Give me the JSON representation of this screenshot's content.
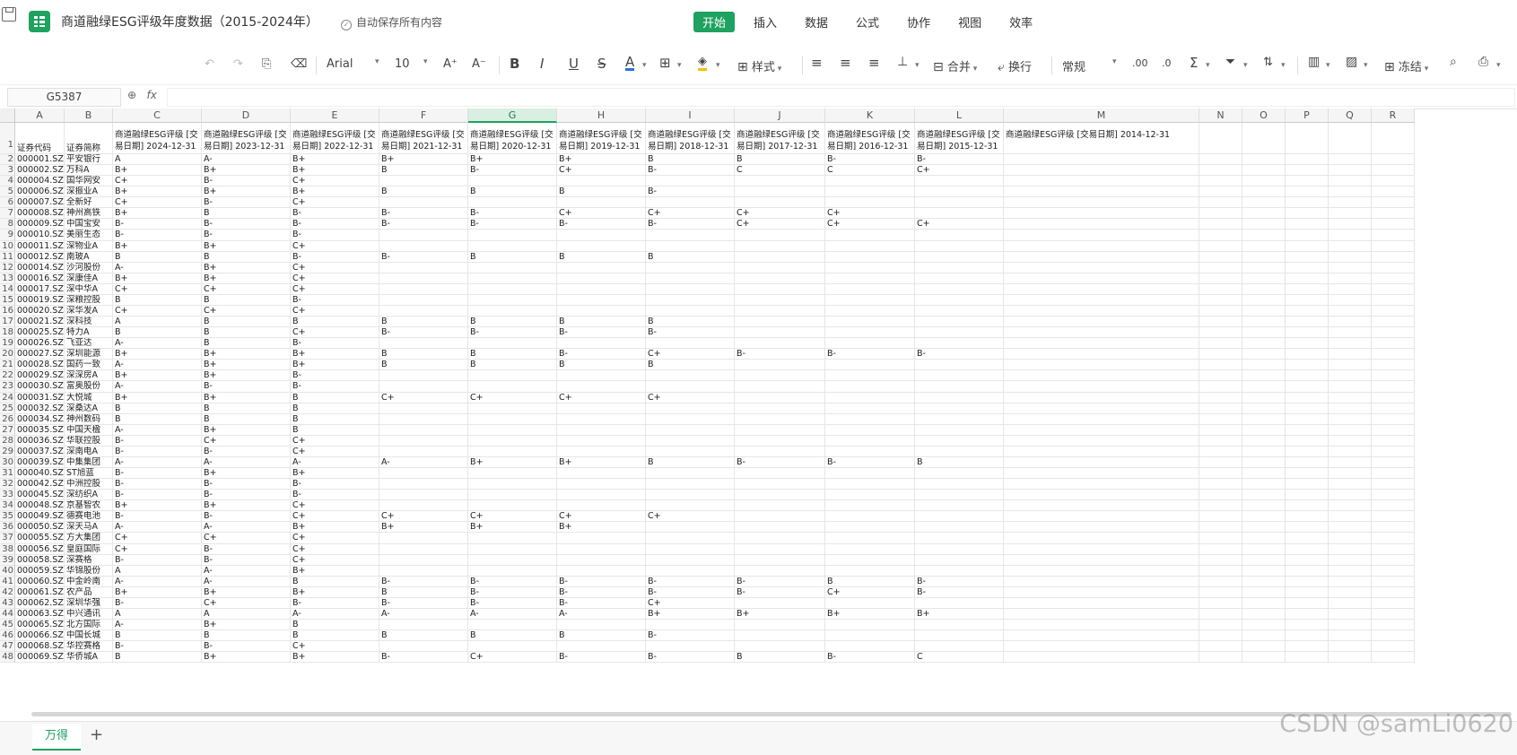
{
  "app": {
    "doc_title": "商道融绿ESG评级年度数据（2015-2024年）",
    "autosave_text": "自动保存所有内容",
    "menu": [
      "开始",
      "插入",
      "数据",
      "公式",
      "协作",
      "视图",
      "效率"
    ],
    "active_menu_index": 0,
    "accent_color": "#1fa15f"
  },
  "toolbar": {
    "font_name": "Arial",
    "font_size": "10",
    "bold": "B",
    "italic": "I",
    "underline": "U",
    "strike": "S",
    "font_color": "A",
    "style_label": "样式",
    "merge_label": "合并",
    "wrap_label": "换行",
    "number_format": "常规",
    "freeze_label": "冻结"
  },
  "formula_bar": {
    "cell_ref": "G5387",
    "fx": "fx",
    "content": ""
  },
  "grid": {
    "columns": [
      "A",
      "B",
      "C",
      "D",
      "E",
      "F",
      "G",
      "H",
      "I",
      "J",
      "K",
      "L",
      "M",
      "N",
      "O",
      "P",
      "Q",
      "R"
    ],
    "selected_column": "G",
    "header_row": [
      "证券代码",
      "证券简称",
      "商道融绿ESG评级 [交易日期] 2024-12-31",
      "商道融绿ESG评级 [交易日期] 2023-12-31",
      "商道融绿ESG评级 [交易日期] 2022-12-31",
      "商道融绿ESG评级 [交易日期] 2021-12-31",
      "商道融绿ESG评级 [交易日期] 2020-12-31",
      "商道融绿ESG评级 [交易日期] 2019-12-31",
      "商道融绿ESG评级 [交易日期] 2018-12-31",
      "商道融绿ESG评级 [交易日期] 2017-12-31",
      "商道融绿ESG评级 [交易日期] 2016-12-31",
      "商道融绿ESG评级 [交易日期] 2015-12-31",
      "商道融绿ESG评级 [交易日期] 2014-12-31"
    ],
    "rows": [
      [
        "000001.SZ",
        "平安银行",
        "A",
        "A-",
        "B+",
        "B+",
        "B+",
        "B+",
        "B",
        "B",
        "B-",
        "B-"
      ],
      [
        "000002.SZ",
        "万科A",
        "B+",
        "B+",
        "B+",
        "B",
        "B-",
        "C+",
        "B-",
        "C",
        "C",
        "C+"
      ],
      [
        "000004.SZ",
        "国华网安",
        "C+",
        "B-",
        "C+",
        "",
        "",
        "",
        "",
        "",
        "",
        ""
      ],
      [
        "000006.SZ",
        "深振业A",
        "B+",
        "B+",
        "B+",
        "B",
        "B",
        "B",
        "B-",
        "",
        "",
        ""
      ],
      [
        "000007.SZ",
        "全新好",
        "C+",
        "B-",
        "C+",
        "",
        "",
        "",
        "",
        "",
        "",
        ""
      ],
      [
        "000008.SZ",
        "神州高铁",
        "B+",
        "B",
        "B-",
        "B-",
        "B-",
        "C+",
        "C+",
        "C+",
        "C+",
        ""
      ],
      [
        "000009.SZ",
        "中国宝安",
        "B-",
        "B-",
        "B-",
        "B-",
        "B-",
        "B-",
        "B-",
        "C+",
        "C+",
        "C+"
      ],
      [
        "000010.SZ",
        "美丽生态",
        "B-",
        "B-",
        "B-",
        "",
        "",
        "",
        "",
        "",
        "",
        ""
      ],
      [
        "000011.SZ",
        "深物业A",
        "B+",
        "B+",
        "C+",
        "",
        "",
        "",
        "",
        "",
        "",
        ""
      ],
      [
        "000012.SZ",
        "南玻A",
        "B",
        "B",
        "B-",
        "B-",
        "B",
        "B",
        "B",
        "",
        "",
        ""
      ],
      [
        "000014.SZ",
        "沙河股份",
        "A-",
        "B+",
        "C+",
        "",
        "",
        "",
        "",
        "",
        "",
        ""
      ],
      [
        "000016.SZ",
        "深康佳A",
        "B+",
        "B+",
        "C+",
        "",
        "",
        "",
        "",
        "",
        "",
        ""
      ],
      [
        "000017.SZ",
        "深中华A",
        "C+",
        "C+",
        "C+",
        "",
        "",
        "",
        "",
        "",
        "",
        ""
      ],
      [
        "000019.SZ",
        "深粮控股",
        "B",
        "B",
        "B-",
        "",
        "",
        "",
        "",
        "",
        "",
        ""
      ],
      [
        "000020.SZ",
        "深华发A",
        "C+",
        "C+",
        "C+",
        "",
        "",
        "",
        "",
        "",
        "",
        ""
      ],
      [
        "000021.SZ",
        "深科技",
        "A",
        "B",
        "B",
        "B",
        "B",
        "B",
        "B",
        "",
        "",
        ""
      ],
      [
        "000025.SZ",
        "特力A",
        "B",
        "B",
        "C+",
        "B-",
        "B-",
        "B-",
        "B-",
        "",
        "",
        ""
      ],
      [
        "000026.SZ",
        "飞亚达",
        "A-",
        "B",
        "B-",
        "",
        "",
        "",
        "",
        "",
        "",
        ""
      ],
      [
        "000027.SZ",
        "深圳能源",
        "B+",
        "B+",
        "B+",
        "B",
        "B",
        "B-",
        "C+",
        "B-",
        "B-",
        "B-"
      ],
      [
        "000028.SZ",
        "国药一致",
        "A-",
        "B+",
        "B+",
        "B",
        "B",
        "B",
        "B",
        "",
        "",
        ""
      ],
      [
        "000029.SZ",
        "深深房A",
        "B+",
        "B+",
        "B-",
        "",
        "",
        "",
        "",
        "",
        "",
        ""
      ],
      [
        "000030.SZ",
        "富奥股份",
        "A-",
        "B-",
        "B-",
        "",
        "",
        "",
        "",
        "",
        "",
        ""
      ],
      [
        "000031.SZ",
        "大悦城",
        "B+",
        "B+",
        "B",
        "C+",
        "C+",
        "C+",
        "C+",
        "",
        "",
        ""
      ],
      [
        "000032.SZ",
        "深桑达A",
        "B",
        "B",
        "B",
        "",
        "",
        "",
        "",
        "",
        "",
        ""
      ],
      [
        "000034.SZ",
        "神州数码",
        "B",
        "B",
        "B",
        "",
        "",
        "",
        "",
        "",
        "",
        ""
      ],
      [
        "000035.SZ",
        "中国天楹",
        "A-",
        "B+",
        "B",
        "",
        "",
        "",
        "",
        "",
        "",
        ""
      ],
      [
        "000036.SZ",
        "华联控股",
        "B-",
        "C+",
        "C+",
        "",
        "",
        "",
        "",
        "",
        "",
        ""
      ],
      [
        "000037.SZ",
        "深南电A",
        "B-",
        "B-",
        "C+",
        "",
        "",
        "",
        "",
        "",
        "",
        ""
      ],
      [
        "000039.SZ",
        "中集集团",
        "A-",
        "A-",
        "A-",
        "A-",
        "B+",
        "B+",
        "B",
        "B-",
        "B-",
        "B"
      ],
      [
        "000040.SZ",
        "ST旭蓝",
        "B-",
        "B+",
        "B+",
        "",
        "",
        "",
        "",
        "",
        "",
        ""
      ],
      [
        "000042.SZ",
        "中洲控股",
        "B-",
        "B-",
        "B-",
        "",
        "",
        "",
        "",
        "",
        "",
        ""
      ],
      [
        "000045.SZ",
        "深纺织A",
        "B-",
        "B-",
        "B-",
        "",
        "",
        "",
        "",
        "",
        "",
        ""
      ],
      [
        "000048.SZ",
        "京基智农",
        "B+",
        "B+",
        "C+",
        "",
        "",
        "",
        "",
        "",
        "",
        ""
      ],
      [
        "000049.SZ",
        "德赛电池",
        "B-",
        "B-",
        "C+",
        "C+",
        "C+",
        "C+",
        "C+",
        "",
        "",
        ""
      ],
      [
        "000050.SZ",
        "深天马A",
        "A-",
        "A-",
        "B+",
        "B+",
        "B+",
        "B+",
        "",
        "",
        "",
        ""
      ],
      [
        "000055.SZ",
        "方大集团",
        "C+",
        "C+",
        "C+",
        "",
        "",
        "",
        "",
        "",
        "",
        ""
      ],
      [
        "000056.SZ",
        "皇庭国际",
        "C+",
        "B-",
        "C+",
        "",
        "",
        "",
        "",
        "",
        "",
        ""
      ],
      [
        "000058.SZ",
        "深赛格",
        "B-",
        "B-",
        "C+",
        "",
        "",
        "",
        "",
        "",
        "",
        ""
      ],
      [
        "000059.SZ",
        "华锦股份",
        "A",
        "A-",
        "B+",
        "",
        "",
        "",
        "",
        "",
        "",
        ""
      ],
      [
        "000060.SZ",
        "中金岭南",
        "A-",
        "A-",
        "B",
        "B-",
        "B-",
        "B-",
        "B-",
        "B-",
        "B",
        "B-"
      ],
      [
        "000061.SZ",
        "农产品",
        "B+",
        "B+",
        "B+",
        "B",
        "B-",
        "B-",
        "B-",
        "B-",
        "C+",
        "B-"
      ],
      [
        "000062.SZ",
        "深圳华强",
        "B-",
        "C+",
        "B-",
        "B-",
        "B-",
        "B-",
        "C+",
        "",
        "",
        ""
      ],
      [
        "000063.SZ",
        "中兴通讯",
        "A",
        "A",
        "A-",
        "A-",
        "A-",
        "A-",
        "B+",
        "B+",
        "B+",
        "B+"
      ],
      [
        "000065.SZ",
        "北方国际",
        "A-",
        "B+",
        "B",
        "",
        "",
        "",
        "",
        "",
        "",
        ""
      ],
      [
        "000066.SZ",
        "中国长城",
        "B",
        "B",
        "B",
        "B",
        "B",
        "B",
        "B-",
        "",
        "",
        ""
      ],
      [
        "000068.SZ",
        "华控赛格",
        "B-",
        "B-",
        "C+",
        "",
        "",
        "",
        "",
        "",
        "",
        ""
      ],
      [
        "000069.SZ",
        "华侨城A",
        "B",
        "B+",
        "B+",
        "B-",
        "C+",
        "B-",
        "B-",
        "B",
        "B-",
        "C"
      ]
    ]
  },
  "sheets": {
    "tabs": [
      "万得"
    ],
    "add": "+"
  },
  "watermark": "CSDN @samLi0620"
}
